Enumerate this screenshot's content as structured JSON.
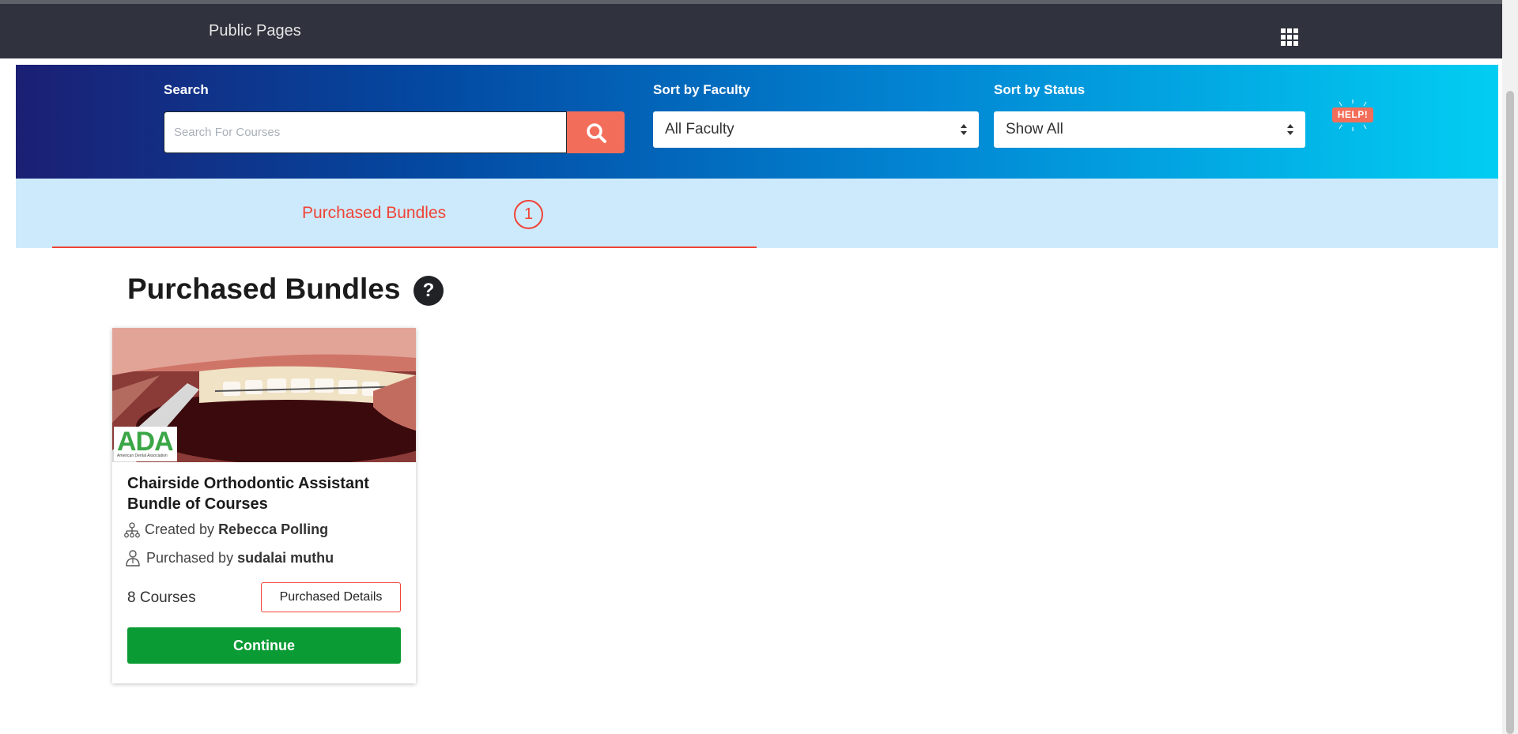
{
  "topbar": {
    "public_pages": "Public Pages"
  },
  "filters": {
    "search_label": "Search",
    "search_placeholder": "Search For Courses",
    "search_value": "",
    "faculty_label": "Sort by Faculty",
    "faculty_selected": "All Faculty",
    "status_label": "Sort by Status",
    "status_selected": "Show All",
    "help_label": "HELP!"
  },
  "tabs": [
    {
      "label": "Purchased Bundles",
      "count": "1",
      "active": true
    }
  ],
  "main": {
    "title": "Purchased Bundles",
    "help_icon": "?"
  },
  "bundles": [
    {
      "image_badge": "ADA",
      "image_badge_sub": "American Dental Association",
      "title": "Chairside Orthodontic Assistant Bundle of Courses",
      "created_prefix": "Created by",
      "created_by": "Rebecca Polling",
      "purchased_prefix": "Purchased by",
      "purchased_by": "sudalai muthu",
      "courses": "8 Courses",
      "details_label": "Purchased Details",
      "continue_label": "Continue"
    }
  ],
  "colors": {
    "topbar": "#30323d",
    "accent": "#f36e5a",
    "tab_active": "#f04336",
    "continue": "#0a9b34",
    "tab_band": "#cdeafc"
  }
}
